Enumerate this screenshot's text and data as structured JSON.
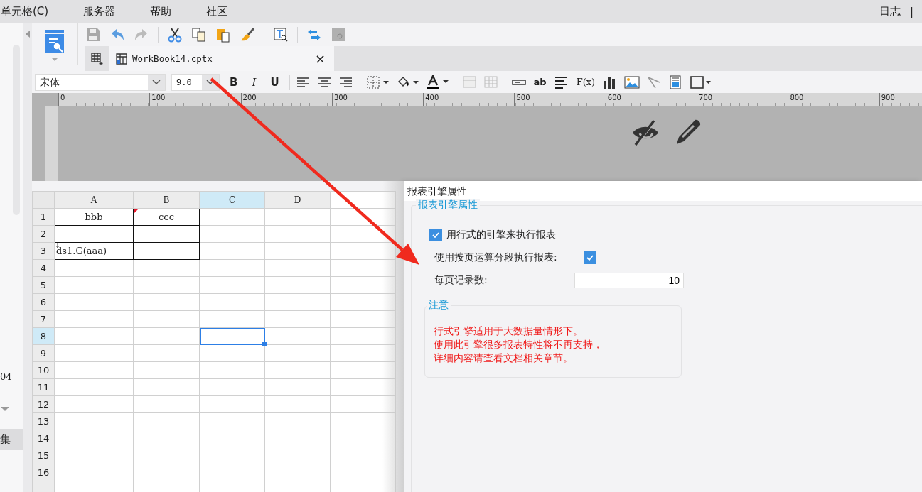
{
  "menu": [
    {
      "label": "单元格(C)"
    },
    {
      "label": "服务器"
    },
    {
      "label": "帮助"
    },
    {
      "label": "社区"
    }
  ],
  "menu_right": [
    {
      "label": "日志"
    },
    {
      "label": "|"
    }
  ],
  "side_panel": {
    "texts": [
      "04",
      "集"
    ]
  },
  "tab": {
    "label": "WorkBook14.cptx",
    "selected": true,
    "close": "×"
  },
  "font": {
    "value": "宋体"
  },
  "font_size": {
    "value": "9.0"
  },
  "style_buttons": [
    {
      "label": "B",
      "kind": "bold"
    },
    {
      "label": "I",
      "kind": "italic"
    },
    {
      "label": "U",
      "kind": "underline"
    }
  ],
  "insert_buttons": [
    {
      "label": "ab",
      "kind": "text"
    },
    {
      "label": "F(x)",
      "kind": "formula"
    }
  ],
  "ruler": {
    "ticks": [
      "0",
      "100",
      "200",
      "300",
      "400",
      "500",
      "600",
      "700",
      "800",
      "900"
    ]
  },
  "sheet": {
    "columns": [
      {
        "label": "A",
        "selected": false
      },
      {
        "label": "B",
        "selected": false
      },
      {
        "label": "C",
        "selected": true
      },
      {
        "label": "D",
        "selected": false
      }
    ],
    "rows": [
      {
        "label": "1",
        "selected": false,
        "bordered": true,
        "cells": [
          {
            "text": "bbb",
            "centered": true
          },
          {
            "text": "ccc",
            "centered": true,
            "marked": true
          }
        ]
      },
      {
        "label": "2",
        "selected": false,
        "bordered": true
      },
      {
        "label": "3",
        "selected": false,
        "bordered": true,
        "cells": [
          {
            "text": "ds1.G(aaa)",
            "centered": false,
            "expand": true
          }
        ]
      },
      {
        "label": "4",
        "selected": false,
        "bordered": false
      },
      {
        "label": "5",
        "selected": false,
        "bordered": false
      },
      {
        "label": "6",
        "selected": false,
        "bordered": false
      },
      {
        "label": "7",
        "selected": false,
        "bordered": false
      },
      {
        "label": "8",
        "selected": true,
        "bordered": false
      },
      {
        "label": "9",
        "selected": false,
        "bordered": false
      },
      {
        "label": "10",
        "selected": false,
        "bordered": false
      },
      {
        "label": "11",
        "selected": false,
        "bordered": false
      },
      {
        "label": "12",
        "selected": false,
        "bordered": false
      },
      {
        "label": "13",
        "selected": false,
        "bordered": false
      },
      {
        "label": "14",
        "selected": false,
        "bordered": false
      },
      {
        "label": "15",
        "selected": false,
        "bordered": false
      },
      {
        "label": "16",
        "selected": false,
        "bordered": false
      }
    ]
  },
  "dialog": {
    "title": "报表引擎属性",
    "group_title": "报表引擎属性",
    "options": [
      {
        "kind": "checkbox",
        "label": "用行式的引擎来执行报表",
        "checked": true
      },
      {
        "kind": "checkbox_after",
        "label": "使用按页运算分段执行报表:",
        "checked": true
      },
      {
        "kind": "number",
        "label": "每页记录数:",
        "value": "10"
      }
    ],
    "note": {
      "title": "注意",
      "lines": [
        "行式引擎适用于大数据量情形下。",
        "使用此引擎很多报表特性将不再支持，",
        "详细内容请查看文档相关章节。"
      ]
    }
  }
}
